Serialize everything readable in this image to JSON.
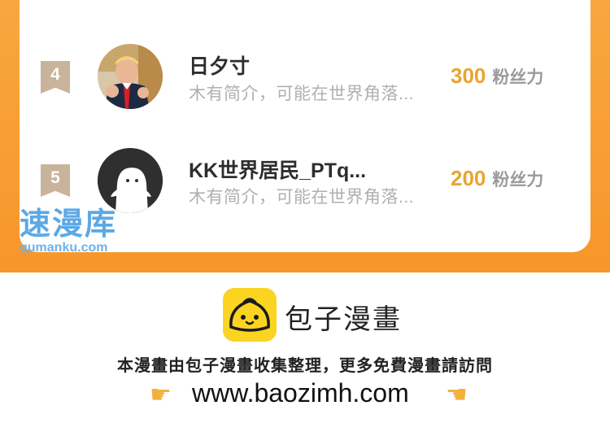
{
  "ranking": [
    {
      "rank": "4",
      "name": "日夕寸",
      "intro": "木有简介，可能在世界角落...",
      "fans_value": "300",
      "fans_unit": "粉丝力",
      "avatar": "photo-avatar"
    },
    {
      "rank": "5",
      "name": "KK世界居民_PTq...",
      "intro": "木有简介，可能在世界角落...",
      "fans_value": "200",
      "fans_unit": "粉丝力",
      "avatar": "default-ghost-avatar"
    }
  ],
  "watermark": {
    "title": "速漫库",
    "url": "qumanku.com"
  },
  "footer": {
    "brand_name": "包子漫畫",
    "notice": "本漫畫由包子漫畫收集整理，更多免費漫畫請訪問",
    "site_url": "www.baozimh.com",
    "left_icon": "pointing-right-hand-icon",
    "right_icon": "pointing-left-hand-icon"
  },
  "colors": {
    "band_orange": "#f7962a",
    "fans_gold": "#e8a532",
    "rank_badge": "#c9b39a",
    "logo_yellow": "#fbd422",
    "watermark_blue": "#5aa9e6"
  }
}
